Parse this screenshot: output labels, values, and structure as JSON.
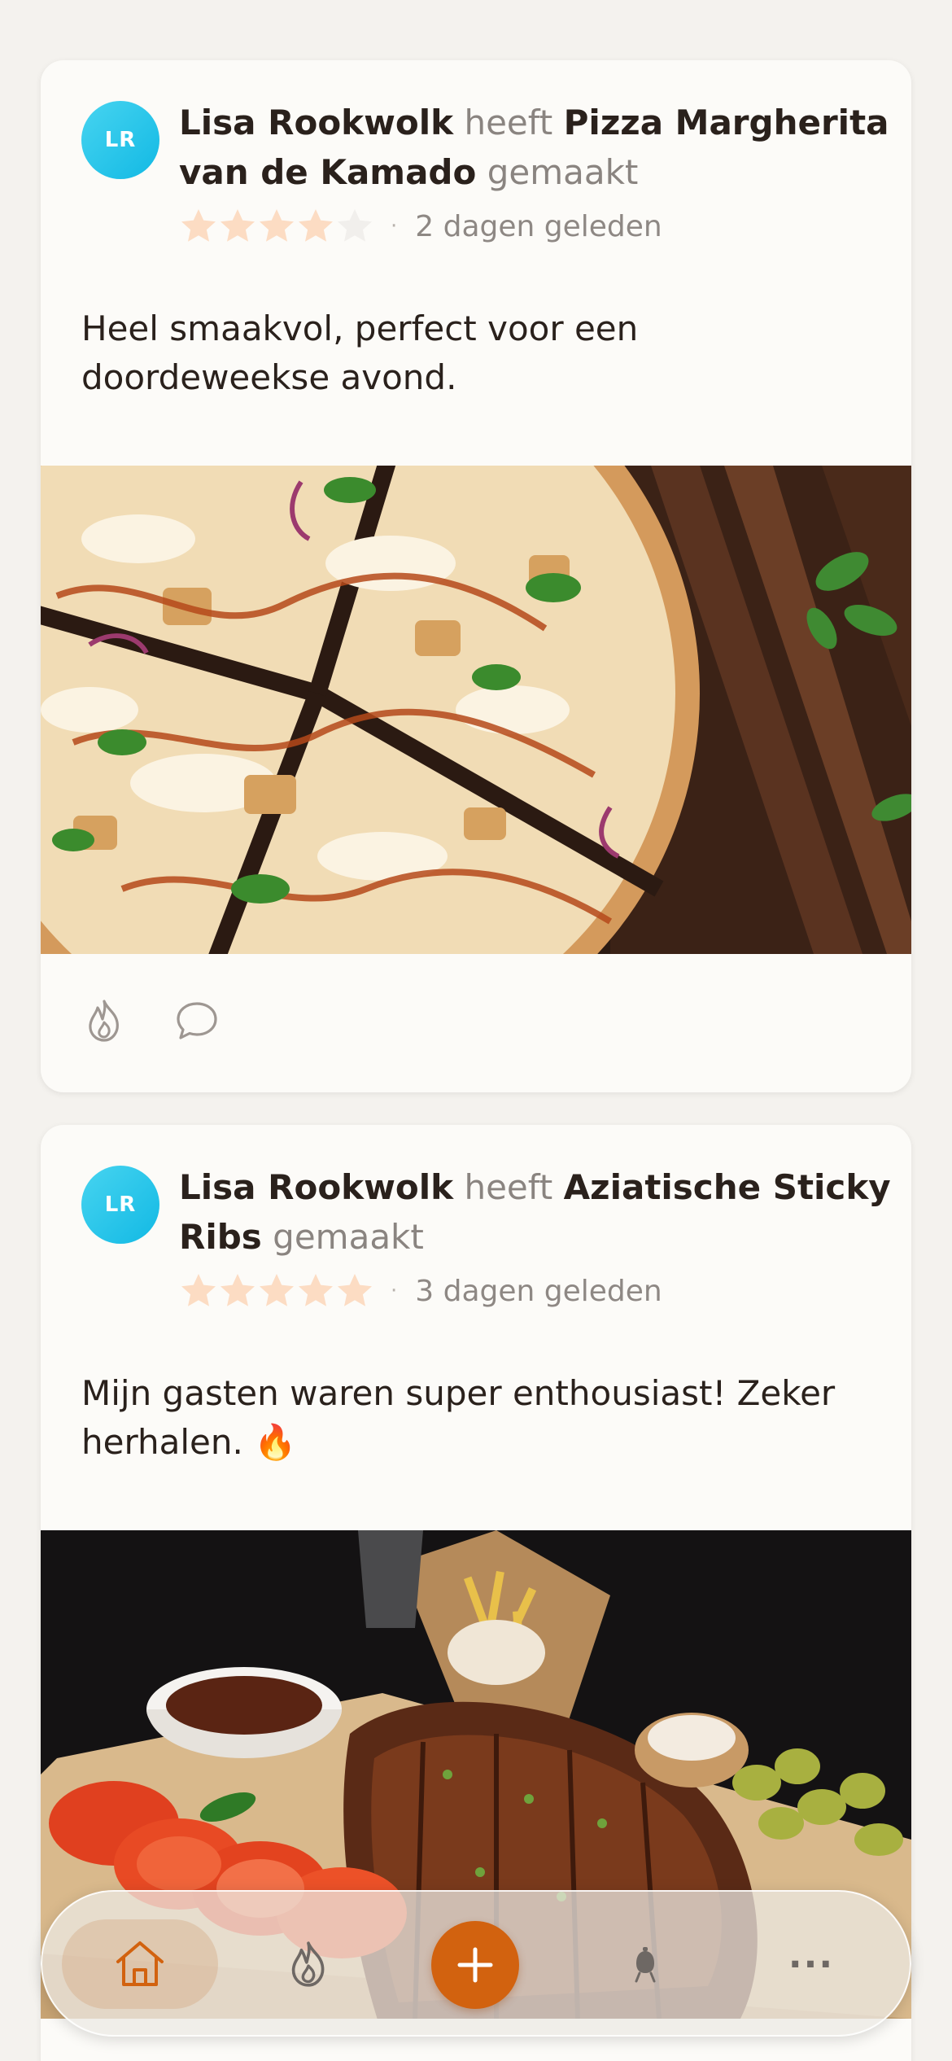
{
  "feed": {
    "posts": [
      {
        "avatar_initials": "LR",
        "author": "Lisa Rookwolk",
        "verb": "heeft",
        "recipe": "Pizza Margherita van de Kamado",
        "suffix": "gemaakt",
        "rating": 4,
        "rating_max": 5,
        "time_ago": "2 dagen geleden",
        "comment": "Heel smaakvol, perfect voor een doordeweekse avond.",
        "photo_icon": "bbq-chicken-pizza-photo"
      },
      {
        "avatar_initials": "LR",
        "author": "Lisa Rookwolk",
        "verb": "heeft",
        "recipe": "Aziatische Sticky Ribs",
        "suffix": "gemaakt",
        "rating": 5,
        "rating_max": 5,
        "time_ago": "3 dagen geleden",
        "comment": "Mijn gasten waren super enthousiast! Zeker herhalen. 🔥",
        "photo_icon": "sticky-ribs-platter-photo"
      }
    ],
    "meta_separator": "·"
  },
  "nav": {
    "items": [
      "home-icon",
      "flame-icon",
      "plus-icon",
      "kamado-grill-icon",
      "more-icon"
    ],
    "more_label": "···"
  },
  "colors": {
    "accent": "#d2620f",
    "star_filled": "#fcdcc3",
    "star_empty": "#f1efec",
    "avatar": "#1fc1e8",
    "text": "#2a211c",
    "muted": "#8a8480"
  }
}
